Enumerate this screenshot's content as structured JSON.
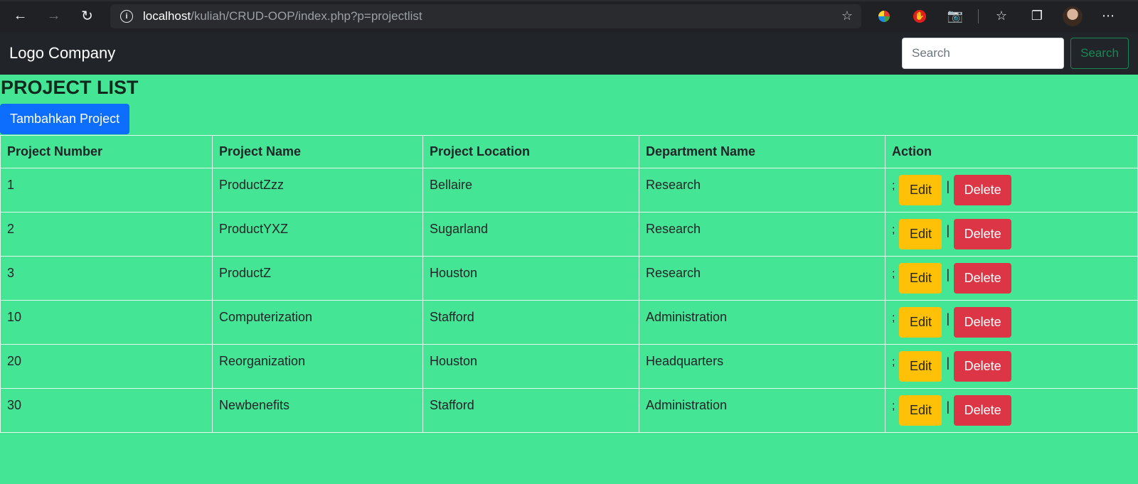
{
  "browser": {
    "url_host": "localhost",
    "url_path": "/kuliah/CRUD-OOP/index.php?p=projectlist"
  },
  "navbar": {
    "brand": "Logo Company",
    "search_placeholder": "Search",
    "search_button": "Search"
  },
  "page": {
    "title": "PROJECT LIST",
    "add_button": "Tambahkan Project"
  },
  "table": {
    "headers": [
      "Project Number",
      "Project Name",
      "Project Location",
      "Department Name",
      "Action"
    ],
    "rows": [
      {
        "number": "1",
        "name": "ProductZzz",
        "location": "Bellaire",
        "department": "Research"
      },
      {
        "number": "2",
        "name": "ProductYXZ",
        "location": "Sugarland",
        "department": "Research"
      },
      {
        "number": "3",
        "name": "ProductZ",
        "location": "Houston",
        "department": "Research"
      },
      {
        "number": "10",
        "name": "Computerization",
        "location": "Stafford",
        "department": "Administration"
      },
      {
        "number": "20",
        "name": "Reorganization",
        "location": "Houston",
        "department": "Headquarters"
      },
      {
        "number": "30",
        "name": "Newbenefits",
        "location": "Stafford",
        "department": "Administration"
      }
    ],
    "action_prefix": ";",
    "action_separator": "|",
    "edit_label": "Edit",
    "delete_label": "Delete"
  },
  "colors": {
    "page_background": "#44e695",
    "navbar": "#212529",
    "primary": "#0d6efd",
    "warning": "#ffc107",
    "danger": "#dc3545",
    "success": "#198754"
  }
}
